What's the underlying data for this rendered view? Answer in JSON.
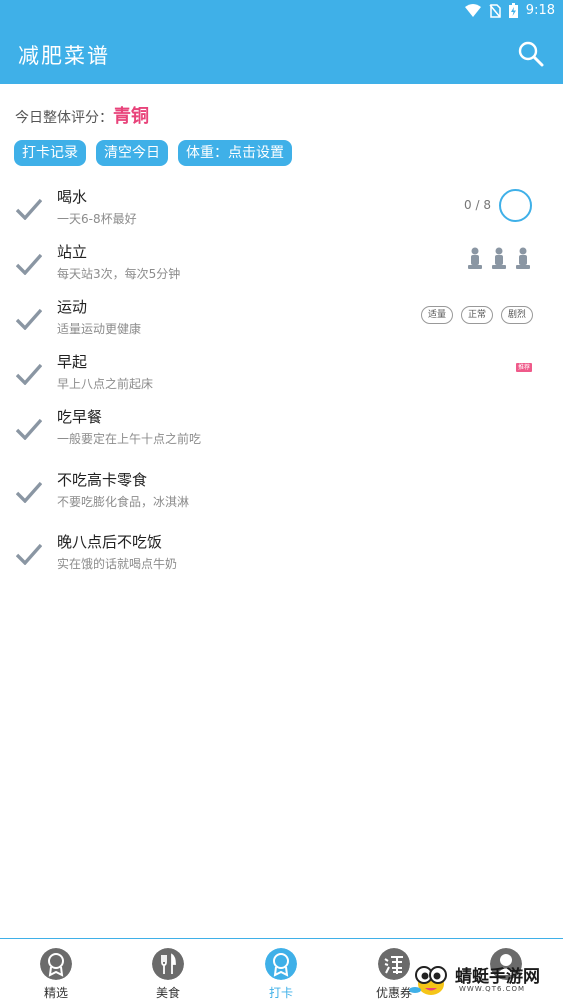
{
  "status_bar": {
    "time": "9:18"
  },
  "app_bar": {
    "title": "减肥菜谱",
    "search_icon": "search-icon"
  },
  "score": {
    "label": "今日整体评分：",
    "grade": "青铜",
    "grade_color": "#e8437a"
  },
  "actions": [
    {
      "label": "打卡记录"
    },
    {
      "label": "清空今日"
    },
    {
      "label": "体重：点击设置"
    }
  ],
  "tasks": [
    {
      "title": "喝水",
      "subtitle": "一天6-8杯最好",
      "count": "0 / 8"
    },
    {
      "title": "站立",
      "subtitle": "每天站3次，每次5分钟"
    },
    {
      "title": "运动",
      "subtitle": "适量运动更健康",
      "levels": [
        "适量",
        "正常",
        "剧烈"
      ]
    },
    {
      "title": "早起",
      "subtitle": "早上八点之前起床",
      "badge": "推荐"
    },
    {
      "title": "吃早餐",
      "subtitle": "一般要定在上午十点之前吃"
    },
    {
      "title": "不吃高卡零食",
      "subtitle": "不要吃膨化食品，冰淇淋"
    },
    {
      "title": "晚八点后不吃饭",
      "subtitle": "实在饿的话就喝点牛奶"
    }
  ],
  "tabs": [
    {
      "label": "精选",
      "icon": "award-icon"
    },
    {
      "label": "美食",
      "icon": "fork-knife-icon"
    },
    {
      "label": "打卡",
      "icon": "award-icon",
      "active": true
    },
    {
      "label": "优惠券",
      "icon": "taobao-icon"
    },
    {
      "label": "",
      "icon": "profile-icon"
    }
  ],
  "watermark": {
    "text": "蜻蜓手游网",
    "url": "WWW.QT6.COM"
  },
  "colors": {
    "accent": "#3fb0e8",
    "check": "#8a96a3"
  }
}
